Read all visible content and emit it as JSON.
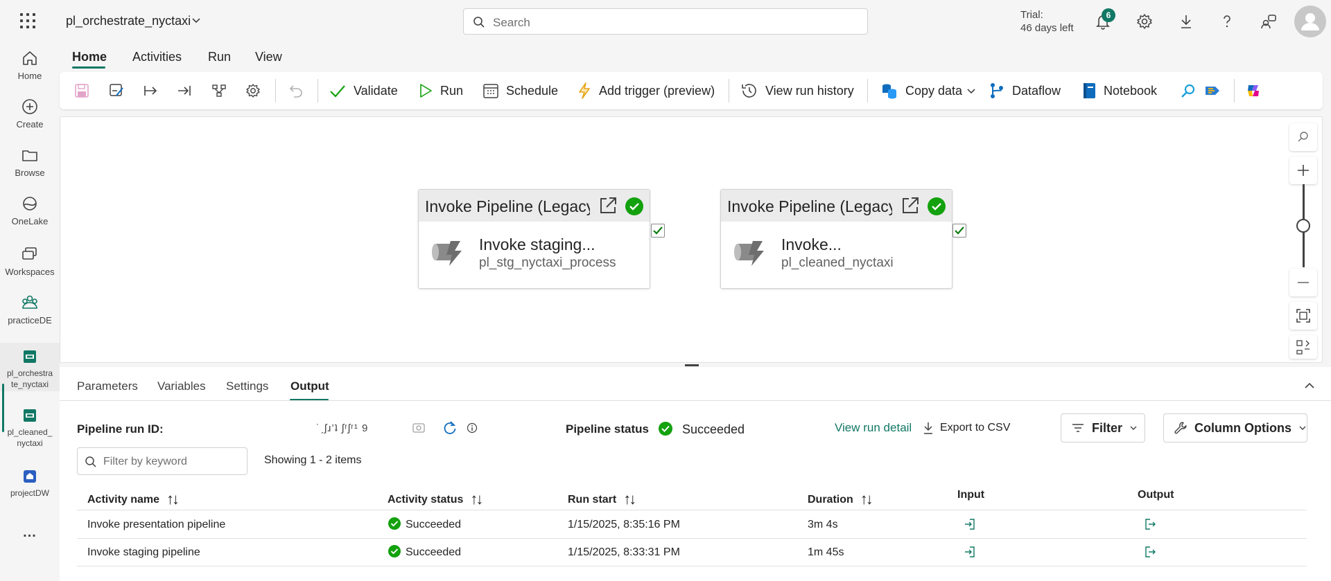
{
  "app": {
    "workspace_title": "pl_orchestrate_nyctaxi",
    "search_placeholder": "Search",
    "trial_line1": "Trial:",
    "trial_line2": "46 days left",
    "notification_count": "6"
  },
  "rail": [
    {
      "label": "Home",
      "icon": "home-icon"
    },
    {
      "label": "Create",
      "icon": "plus-circle-icon"
    },
    {
      "label": "Browse",
      "icon": "folder-icon"
    },
    {
      "label": "OneLake",
      "icon": "onelake-icon"
    },
    {
      "label": "Workspaces",
      "icon": "workspaces-icon"
    },
    {
      "label": "practiceDE",
      "icon": "people-icon"
    },
    {
      "label": "pl_orchestra te_nyctaxi",
      "icon": "pipeline-icon"
    },
    {
      "label": "pl_cleaned_ nyctaxi",
      "icon": "pipeline-icon"
    },
    {
      "label": "projectDW",
      "icon": "warehouse-icon"
    },
    {
      "label": "...",
      "icon": "more-icon"
    }
  ],
  "ribbon_tabs": [
    "Home",
    "Activities",
    "Run",
    "View"
  ],
  "toolbar": {
    "validate": "Validate",
    "run": "Run",
    "schedule": "Schedule",
    "add_trigger": "Add trigger (preview)",
    "view_run_history": "View run history",
    "copy_data": "Copy data",
    "dataflow": "Dataflow",
    "notebook": "Notebook"
  },
  "canvas": {
    "activities": [
      {
        "type_label": "Invoke Pipeline (Legacy)",
        "name": "Invoke staging...",
        "pipeline": "pl_stg_nyctaxi_process",
        "status": "success"
      },
      {
        "type_label": "Invoke Pipeline (Legacy)",
        "name": "Invoke...",
        "pipeline": "pl_cleaned_nyctaxi",
        "status": "success"
      }
    ]
  },
  "panel": {
    "tabs": [
      "Parameters",
      "Variables",
      "Settings",
      "Output"
    ],
    "active_tab": "Output",
    "run_id_label": "Pipeline run ID:",
    "run_id_value": "˙ˏʃɹ’ʇ ʃʳʃʳ¹ 9",
    "status_label": "Pipeline status",
    "status_value": "Succeeded",
    "view_run_detail": "View run detail",
    "export_csv": "Export to CSV",
    "filter": "Filter",
    "column_options": "Column Options",
    "keyword_placeholder": "Filter by keyword",
    "showing": "Showing 1 - 2 items",
    "columns": [
      "Activity name",
      "Activity status",
      "Run start",
      "Duration",
      "Input",
      "Output"
    ],
    "rows": [
      {
        "activity_name": "Invoke presentation pipeline",
        "status": "Succeeded",
        "run_start": "1/15/2025, 8:35:16 PM",
        "duration": "3m 4s"
      },
      {
        "activity_name": "Invoke staging pipeline",
        "status": "Succeeded",
        "run_start": "1/15/2025, 8:33:31 PM",
        "duration": "1m 45s"
      }
    ]
  },
  "colors": {
    "accent": "#117865",
    "success": "#13a10e",
    "brand_pink": "#e3008c"
  }
}
